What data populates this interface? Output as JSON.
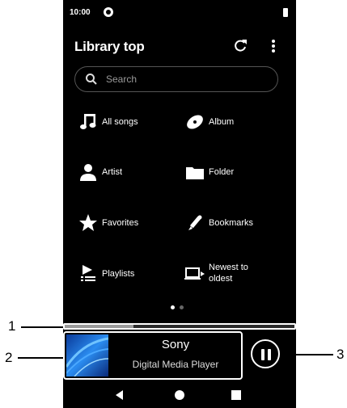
{
  "status": {
    "time": "10:00"
  },
  "appbar": {
    "title": "Library top"
  },
  "search": {
    "placeholder": "Search"
  },
  "grid": [
    {
      "label": "All songs",
      "icon": "music-note-icon"
    },
    {
      "label": "Album",
      "icon": "album-disc-icon"
    },
    {
      "label": "Artist",
      "icon": "artist-person-icon"
    },
    {
      "label": "Folder",
      "icon": "folder-icon"
    },
    {
      "label": "Favorites",
      "icon": "star-icon"
    },
    {
      "label": "Bookmarks",
      "icon": "bookmark-pen-icon"
    },
    {
      "label": "Playlists",
      "icon": "playlist-icon"
    },
    {
      "label": "Newest to oldest",
      "icon": "laptop-transfer-icon"
    }
  ],
  "page_indicator": {
    "pages": 2,
    "current": 1
  },
  "playback": {
    "progress": 0.3,
    "title": "Sony",
    "subtitle": "Digital Media Player",
    "state": "playing"
  },
  "callouts": [
    "1",
    "2",
    "3"
  ],
  "colors": {
    "background": "#000000",
    "accent": "#ffffff",
    "album_art": "#1f6fd6"
  }
}
